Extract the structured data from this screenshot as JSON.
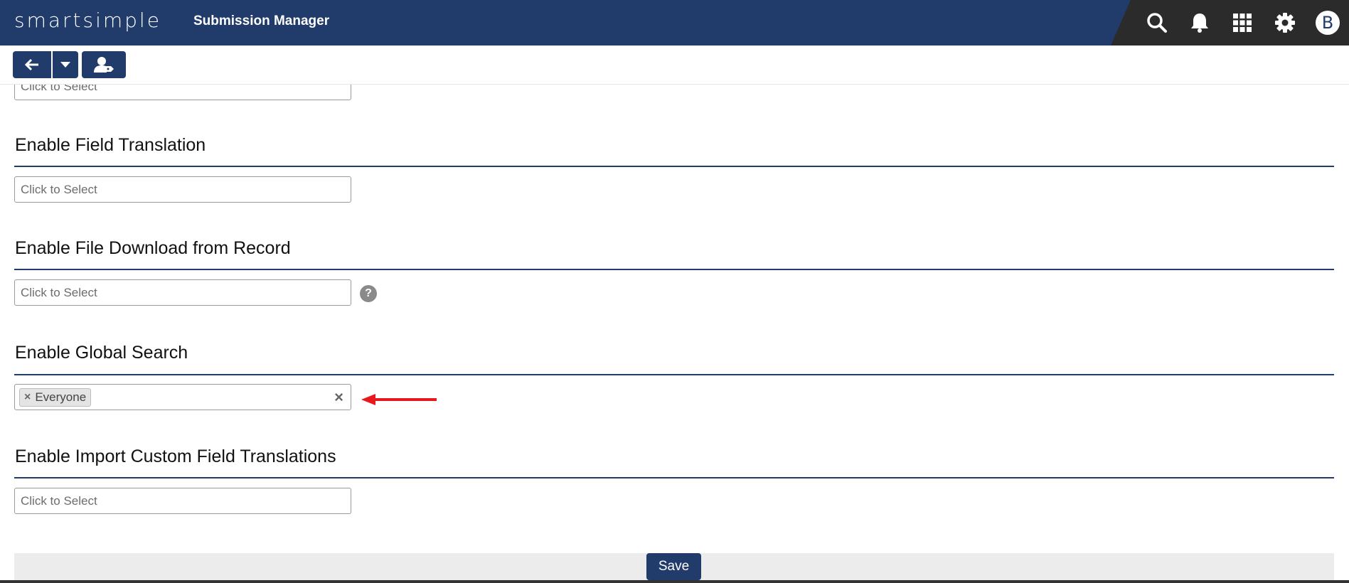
{
  "header": {
    "logo_text": "smartsimple",
    "app_title": "Submission Manager",
    "icons": [
      "search-icon",
      "bell-icon",
      "grid-icon",
      "gear-icon"
    ],
    "avatar_letter": "B",
    "brand_color": "#213b6b"
  },
  "toolbar": {
    "icons": [
      "arrow-left-icon",
      "caret-down-icon",
      "user-tag-icon"
    ]
  },
  "form": {
    "partial_top_placeholder": "Click to Select",
    "sections": [
      {
        "title": "Enable Field Translation",
        "placeholder": "Click to Select"
      },
      {
        "title": "Enable File Download from Record",
        "placeholder": "Click to Select",
        "help": "?"
      },
      {
        "title": "Enable Global Search",
        "selected": [
          "Everyone"
        ]
      },
      {
        "title": "Enable Import Custom Field Translations",
        "placeholder": "Click to Select"
      }
    ],
    "save_label": "Save"
  },
  "annotation": {
    "arrow_color": "#e8191c"
  }
}
